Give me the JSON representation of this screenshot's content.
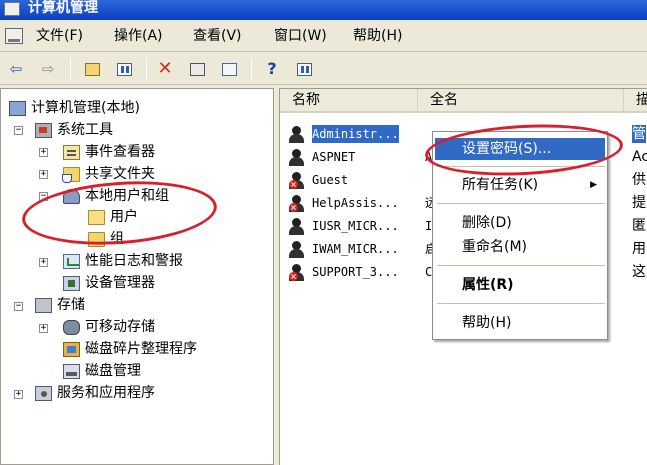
{
  "window": {
    "title": "计算机管理"
  },
  "menubar": {
    "items": [
      {
        "label": "文件(F)"
      },
      {
        "label": "操作(A)"
      },
      {
        "label": "查看(V)"
      },
      {
        "label": "窗口(W)"
      },
      {
        "label": "帮助(H)"
      }
    ]
  },
  "toolbar": {
    "buttons": [
      {
        "icon": "back-arrow-icon",
        "glyph": "⇦"
      },
      {
        "icon": "forward-arrow-icon",
        "glyph": "⇨"
      },
      {
        "icon": "up-folder-icon"
      },
      {
        "icon": "show-hide-tree-icon"
      },
      {
        "icon": "delete-x-icon",
        "glyph": "✕"
      },
      {
        "icon": "properties-icon"
      },
      {
        "icon": "export-list-icon"
      },
      {
        "icon": "help-icon",
        "glyph": "?"
      },
      {
        "icon": "mmc-console-icon"
      }
    ]
  },
  "tree": {
    "items": [
      {
        "label": "计算机管理(本地)",
        "icon": "computer-management-icon"
      },
      {
        "label": "系统工具",
        "icon": "system-tools-icon",
        "expander": "−"
      },
      {
        "label": "事件查看器",
        "icon": "event-viewer-icon",
        "expander": "+"
      },
      {
        "label": "共享文件夹",
        "icon": "shared-folders-icon",
        "expander": "+"
      },
      {
        "label": "本地用户和组",
        "icon": "local-users-groups-icon",
        "expander": "−"
      },
      {
        "label": "用户",
        "icon": "users-folder-icon"
      },
      {
        "label": "组",
        "icon": "groups-folder-icon"
      },
      {
        "label": "性能日志和警报",
        "icon": "performance-logs-icon",
        "expander": "+"
      },
      {
        "label": "设备管理器",
        "icon": "device-manager-icon"
      },
      {
        "label": "存储",
        "icon": "storage-icon",
        "expander": "−"
      },
      {
        "label": "可移动存储",
        "icon": "removable-storage-icon",
        "expander": "+"
      },
      {
        "label": "磁盘碎片整理程序",
        "icon": "disk-defragmenter-icon"
      },
      {
        "label": "磁盘管理",
        "icon": "disk-management-icon"
      },
      {
        "label": "服务和应用程序",
        "icon": "services-applications-icon",
        "expander": "+"
      }
    ]
  },
  "list": {
    "columns": [
      "名称",
      "全名",
      "描"
    ],
    "rows": [
      {
        "name": "Administr...",
        "fullname": "",
        "desc": "管",
        "disabled": false,
        "selected": true
      },
      {
        "name": "ASPNET",
        "fullname": "A",
        "desc": "Ac",
        "disabled": false,
        "selected": false
      },
      {
        "name": "Guest",
        "fullname": "",
        "desc": "供",
        "disabled": true,
        "selected": false
      },
      {
        "name": "HelpAssis...",
        "fullname": "远",
        "desc": "提",
        "disabled": true,
        "selected": false
      },
      {
        "name": "IUSR_MICR...",
        "fullname": "I",
        "desc": "匿",
        "disabled": false,
        "selected": false
      },
      {
        "name": "IWAM_MICR...",
        "fullname": "启",
        "desc": "用",
        "disabled": false,
        "selected": false
      },
      {
        "name": "SUPPORT_3...",
        "fullname": "C",
        "desc": "这",
        "disabled": true,
        "selected": false
      }
    ]
  },
  "context_menu": {
    "items": [
      {
        "label": "设置密码(S)...",
        "highlight": true
      },
      {
        "label": "所有任务(K)",
        "submenu": true,
        "arrow": "▶"
      },
      {
        "label": "删除(D)"
      },
      {
        "label": "重命名(M)"
      },
      {
        "label": "属性(R)",
        "bold": true
      },
      {
        "label": "帮助(H)"
      }
    ]
  },
  "colors": {
    "selection": "#316AC5",
    "annotation": "#D9202A",
    "titlebar": "#0A3FBE"
  }
}
